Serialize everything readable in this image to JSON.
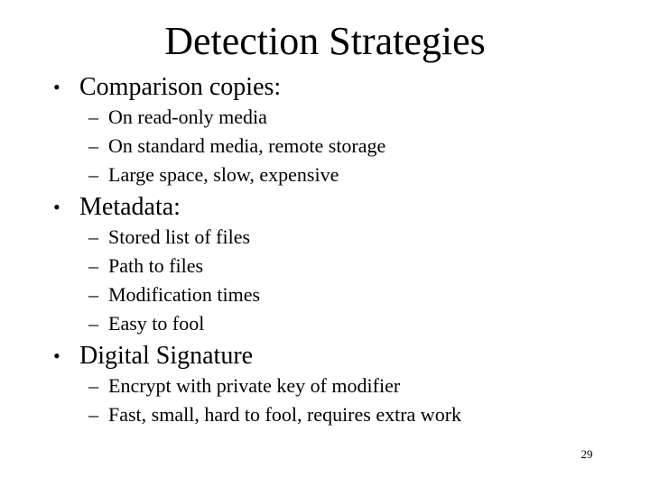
{
  "slide": {
    "title": "Detection Strategies",
    "page_number": "29",
    "bullet_glyph": "•",
    "dash_glyph": "–",
    "sections": [
      {
        "heading": "Comparison copies:",
        "items": [
          "On read-only media",
          "On standard media, remote storage",
          "Large space, slow, expensive"
        ]
      },
      {
        "heading": "Metadata:",
        "items": [
          "Stored list of files",
          "Path to files",
          "Modification times",
          "Easy to fool"
        ]
      },
      {
        "heading": "Digital Signature",
        "items": [
          "Encrypt with private key of modifier",
          "Fast, small, hard to fool, requires extra work"
        ]
      }
    ]
  }
}
